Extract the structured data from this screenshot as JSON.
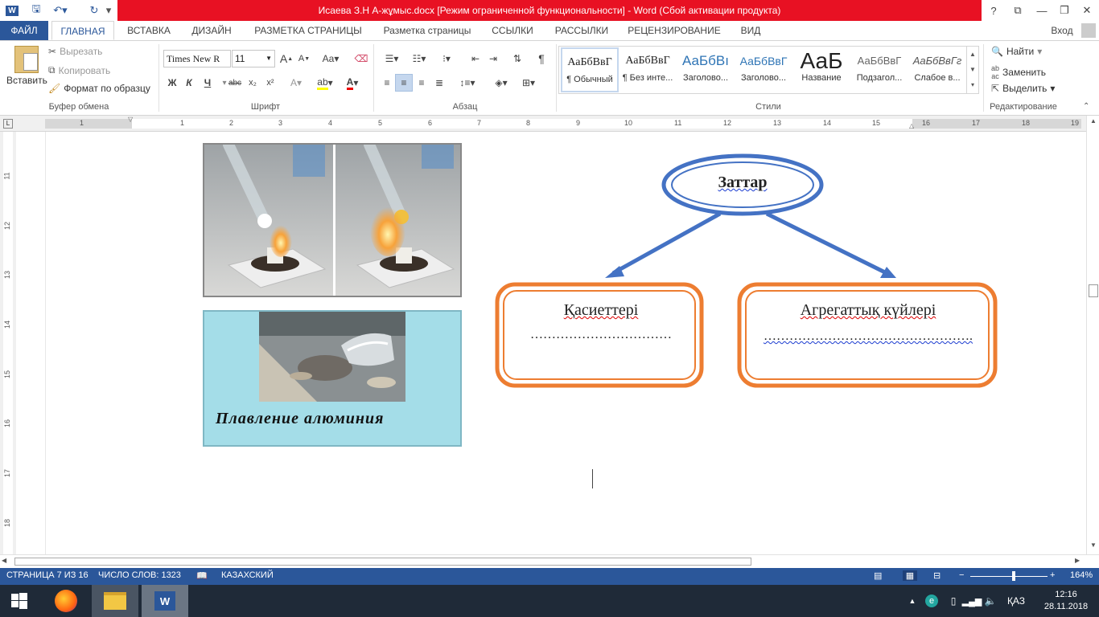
{
  "quick_access": {
    "save_icon": "save-icon",
    "undo_icon": "undo-icon",
    "redo_icon": "redo-icon"
  },
  "title": "Исаева З.Н   А-жұмыс.docx [Режим ограниченной функциональности] -  Word (Сбой активации продукта)",
  "window_controls": {
    "help": "?",
    "restore_ribbon": "⧉",
    "minimize": "—",
    "maximize": "❐",
    "close": "✕"
  },
  "tabs": [
    "ФАЙЛ",
    "ГЛАВНАЯ",
    "ВСТАВКА",
    "ДИЗАЙН",
    "РАЗМЕТКА СТРАНИЦЫ",
    "Разметка страницы",
    "ССЫЛКИ",
    "РАССЫЛКИ",
    "РЕЦЕНЗИРОВАНИЕ",
    "ВИД"
  ],
  "signin": "Вход",
  "clipboard": {
    "paste": "Вставить",
    "cut": "Вырезать",
    "copy": "Копировать",
    "format_painter": "Формат по образцу",
    "label": "Буфер обмена"
  },
  "font": {
    "name": "Times New R",
    "size": "11",
    "label": "Шрифт",
    "bold": "Ж",
    "italic": "К",
    "underline": "Ч",
    "strike": "abc",
    "sub": "x₂",
    "sup": "x²",
    "grow": "A",
    "shrink": "A",
    "case": "Aa"
  },
  "paragraph": {
    "label": "Абзац"
  },
  "styles": {
    "label": "Стили",
    "items": [
      {
        "sample": "АаБбВвГ",
        "name": "¶ Обычный"
      },
      {
        "sample": "АаБбВвГ",
        "name": "¶ Без инте..."
      },
      {
        "sample": "АаБбВı",
        "name": "Заголово..."
      },
      {
        "sample": "АаБбВвГ",
        "name": "Заголово..."
      },
      {
        "sample": "АаБ",
        "name": "Название"
      },
      {
        "sample": "АаБбВвГ",
        "name": "Подзагол..."
      },
      {
        "sample": "АаБбВвГг",
        "name": "Слабое в..."
      }
    ]
  },
  "editing": {
    "find": "Найти",
    "replace": "Заменить",
    "select": "Выделить",
    "label": "Редактирование"
  },
  "ruler_h": [
    "1",
    "1",
    "2",
    "3",
    "4",
    "5",
    "6",
    "7",
    "8",
    "9",
    "10",
    "11",
    "12",
    "13",
    "14",
    "15",
    "16",
    "17",
    "18",
    "19"
  ],
  "ruler_v": [
    "11",
    "12",
    "13",
    "14",
    "15",
    "16",
    "17",
    "18"
  ],
  "document": {
    "photo2_caption": "Плавление алюминия",
    "diagram": {
      "root": "Заттар",
      "left_title": "Қасиеттері",
      "left_dots": "……………………………",
      "right_title": "Агрегаттық күйлері",
      "right_dots": "…………………………………………."
    }
  },
  "status": {
    "page": "СТРАНИЦА 7 ИЗ 16",
    "words": "ЧИСЛО СЛОВ: 1323",
    "language": "КАЗАХСКИЙ",
    "zoom": "164%"
  },
  "taskbar": {
    "lang": "ҚАЗ",
    "time": "12:16",
    "date": "28.11.2018"
  },
  "colors": {
    "accent": "#2b579a",
    "title_red": "#e81123",
    "diagram_blue": "#4472c4",
    "diagram_orange": "#ed7d31"
  }
}
